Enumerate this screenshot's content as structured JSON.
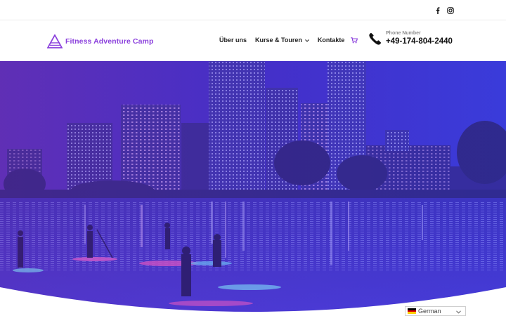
{
  "topbar": {
    "social": [
      {
        "icon": "facebook-icon",
        "glyph": "f"
      },
      {
        "icon": "instagram-icon"
      }
    ]
  },
  "header": {
    "logo_text": "Fitness Adventure Camp",
    "brand_color": "#8a3fdc",
    "nav": [
      {
        "label": "Über uns",
        "has_dropdown": false
      },
      {
        "label": "Kurse & Touren",
        "has_dropdown": true
      },
      {
        "label": "Kontakte",
        "has_dropdown": false
      }
    ],
    "cart_icon": "cart-icon",
    "phone": {
      "label": "Phone Number",
      "number": "+49-174-804-2440",
      "icon": "phone-icon"
    }
  },
  "hero": {
    "overlay_color": "#4a2fd6",
    "image_subject": "city-skyline-night"
  },
  "language": {
    "selected": "German",
    "flag_colors": [
      "#000000",
      "#dd0000",
      "#ffce00"
    ]
  }
}
